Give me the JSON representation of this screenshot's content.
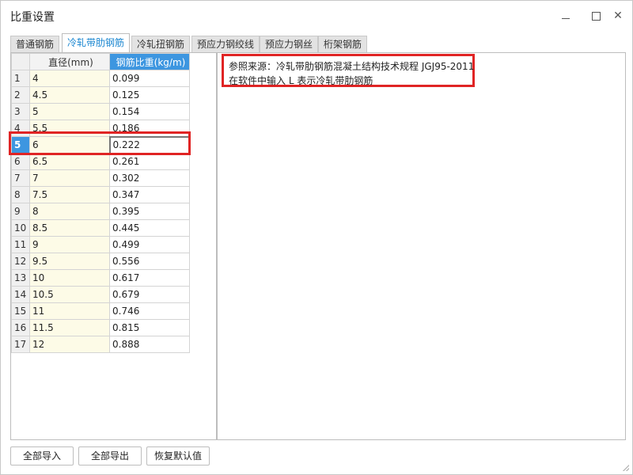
{
  "window": {
    "title": "比重设置",
    "minimize_glyph": "",
    "maximize_glyph": "",
    "close_glyph": "✕"
  },
  "tabs": [
    {
      "label": "普通钢筋",
      "active": false
    },
    {
      "label": "冷轧带肋钢筋",
      "active": true
    },
    {
      "label": "冷轧扭钢筋",
      "active": false
    },
    {
      "label": "预应力钢绞线",
      "active": false
    },
    {
      "label": "预应力钢丝",
      "active": false
    },
    {
      "label": "桁架钢筋",
      "active": false
    }
  ],
  "table": {
    "headers": {
      "diameter": "直径(mm)",
      "weight": "钢筋比重(kg/m)"
    },
    "selected_row": 5,
    "rows": [
      {
        "no": "1",
        "diameter": "4",
        "weight": "0.099"
      },
      {
        "no": "2",
        "diameter": "4.5",
        "weight": "0.125"
      },
      {
        "no": "3",
        "diameter": "5",
        "weight": "0.154"
      },
      {
        "no": "4",
        "diameter": "5.5",
        "weight": "0.186"
      },
      {
        "no": "5",
        "diameter": "6",
        "weight": "0.222"
      },
      {
        "no": "6",
        "diameter": "6.5",
        "weight": "0.261"
      },
      {
        "no": "7",
        "diameter": "7",
        "weight": "0.302"
      },
      {
        "no": "8",
        "diameter": "7.5",
        "weight": "0.347"
      },
      {
        "no": "9",
        "diameter": "8",
        "weight": "0.395"
      },
      {
        "no": "10",
        "diameter": "8.5",
        "weight": "0.445"
      },
      {
        "no": "11",
        "diameter": "9",
        "weight": "0.499"
      },
      {
        "no": "12",
        "diameter": "9.5",
        "weight": "0.556"
      },
      {
        "no": "13",
        "diameter": "10",
        "weight": "0.617"
      },
      {
        "no": "14",
        "diameter": "10.5",
        "weight": "0.679"
      },
      {
        "no": "15",
        "diameter": "11",
        "weight": "0.746"
      },
      {
        "no": "16",
        "diameter": "11.5",
        "weight": "0.815"
      },
      {
        "no": "17",
        "diameter": "12",
        "weight": "0.888"
      }
    ]
  },
  "note": {
    "line1": "参照来源：冷轧带肋钢筋混凝土结构技术规程 JGJ95-2011",
    "line2": "在软件中输入 L 表示冷轧带肋钢筋"
  },
  "buttons": {
    "import_all": "全部导入",
    "export_all": "全部导出",
    "restore_default": "恢复默认值"
  },
  "colors": {
    "accent": "#3d96e0",
    "highlight": "#e02424",
    "diameter_cell_bg": "#fdfbe7"
  }
}
